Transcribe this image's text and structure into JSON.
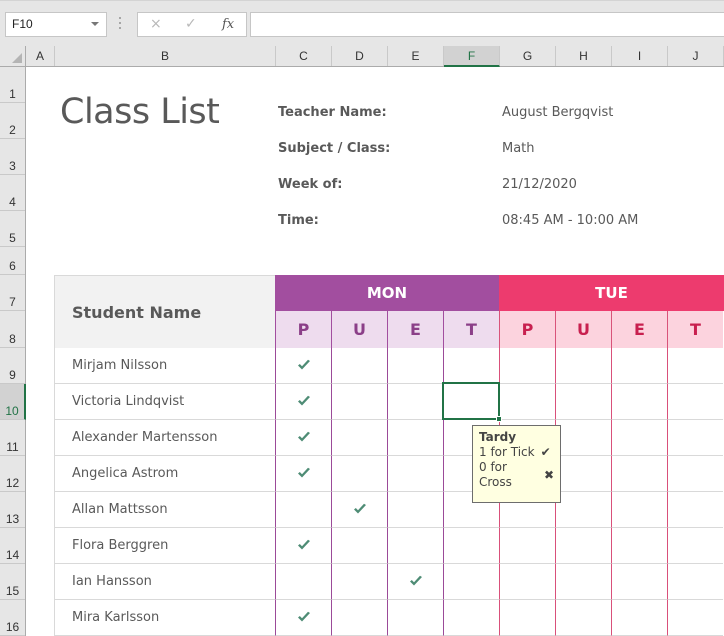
{
  "formula_bar": {
    "name_box": "F10",
    "cancel_icon": "×",
    "enter_icon": "✓",
    "fx_label": "fx",
    "formula": ""
  },
  "columns": [
    "A",
    "B",
    "C",
    "D",
    "E",
    "F",
    "G",
    "H",
    "I",
    "J"
  ],
  "selected_column": "F",
  "rows": [
    "1",
    "2",
    "3",
    "4",
    "5",
    "6",
    "7",
    "8",
    "9",
    "10",
    "11",
    "12",
    "13",
    "14",
    "15",
    "16"
  ],
  "selected_row": "10",
  "sheet": {
    "title": "Class List",
    "info": [
      {
        "label": "Teacher Name:",
        "value": "August Bergqvist"
      },
      {
        "label": "Subject / Class:",
        "value": "Math"
      },
      {
        "label": "Week of:",
        "value": "21/12/2020"
      },
      {
        "label": "Time:",
        "value": "08:45 AM - 10:00 AM"
      }
    ],
    "table": {
      "name_header": "Student Name",
      "days": [
        {
          "label": "MON",
          "color": "#a24e9f",
          "codes": [
            "P",
            "U",
            "E",
            "T"
          ]
        },
        {
          "label": "TUE",
          "color": "#ed3b6e",
          "codes": [
            "P",
            "U",
            "E",
            "T"
          ]
        }
      ],
      "students": [
        {
          "name": "Mirjam Nilsson",
          "mon": "P"
        },
        {
          "name": "Victoria Lindqvist",
          "mon": "P"
        },
        {
          "name": "Alexander Martensson",
          "mon": "P"
        },
        {
          "name": "Angelica Astrom",
          "mon": "P"
        },
        {
          "name": "Allan Mattsson",
          "mon": "U"
        },
        {
          "name": "Flora Berggren",
          "mon": "P"
        },
        {
          "name": "Ian Hansson",
          "mon": "E"
        },
        {
          "name": "Mira Karlsson",
          "mon": "P"
        }
      ],
      "check_color": "#4e8c75"
    },
    "tooltip": {
      "title": "Tardy",
      "lines": [
        {
          "text": "1 for Tick",
          "symbol": "✔"
        },
        {
          "text": "0 for Cross",
          "symbol": "✖"
        }
      ]
    }
  }
}
